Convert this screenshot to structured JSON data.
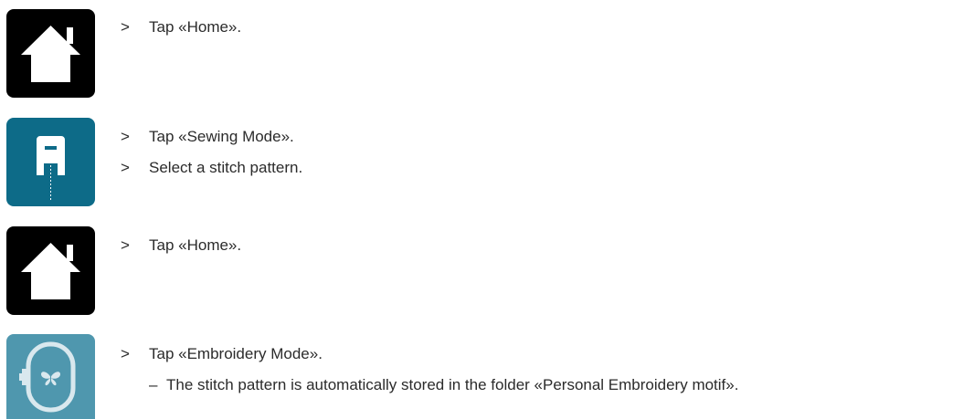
{
  "steps": [
    {
      "icon": "home-icon",
      "lines": [
        {
          "marker": ">",
          "text": "Tap «Home»."
        }
      ]
    },
    {
      "icon": "sewing-mode-icon",
      "lines": [
        {
          "marker": ">",
          "text": "Tap «Sewing Mode»."
        },
        {
          "marker": ">",
          "text": "Select a stitch pattern."
        }
      ]
    },
    {
      "icon": "home-icon",
      "lines": [
        {
          "marker": ">",
          "text": "Tap «Home»."
        }
      ]
    },
    {
      "icon": "embroidery-mode-icon",
      "lines": [
        {
          "marker": ">",
          "text": "Tap «Embroidery Mode»."
        },
        {
          "marker": "–",
          "text": "The stitch pattern is automatically stored in the folder «Personal Embroidery motif»."
        }
      ]
    }
  ],
  "colors": {
    "home_icon_bg": "#000000",
    "sewing_icon_bg": "#0d6b88",
    "embroidery_icon_bg": "#4f97ae",
    "text": "#2b2b2b"
  }
}
